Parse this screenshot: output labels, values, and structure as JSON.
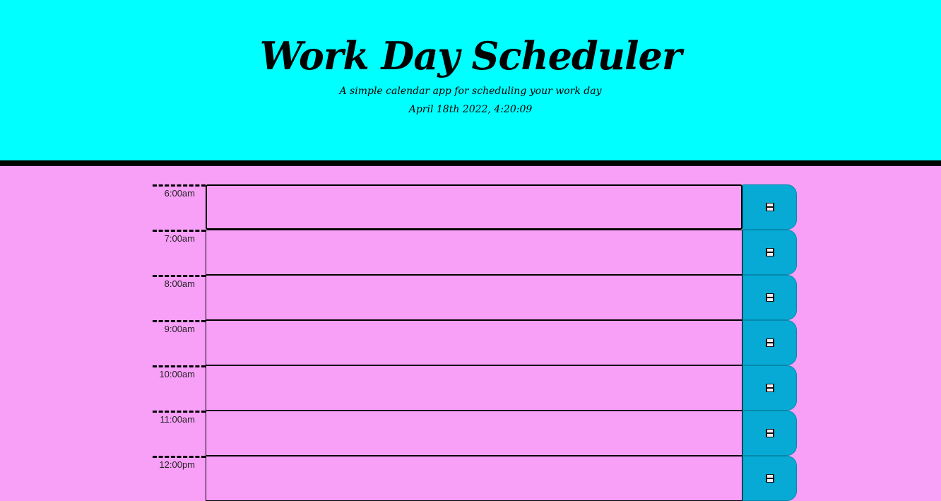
{
  "header": {
    "title": "Work Day Scheduler",
    "lead": "A simple calendar app for scheduling your work day",
    "current_day": "April 18th 2022, 4:20:09"
  },
  "colors": {
    "header_bg": "#00ffff",
    "body_bg": "#f8a0f8",
    "save_button": "#06aad4"
  },
  "timeblocks": [
    {
      "hour": "6:00am",
      "text": "",
      "save_icon": "floppy-disk-icon"
    },
    {
      "hour": "7:00am",
      "text": "",
      "save_icon": "floppy-disk-icon"
    },
    {
      "hour": "8:00am",
      "text": "",
      "save_icon": "floppy-disk-icon"
    },
    {
      "hour": "9:00am",
      "text": "",
      "save_icon": "floppy-disk-icon"
    },
    {
      "hour": "10:00am",
      "text": "",
      "save_icon": "floppy-disk-icon"
    },
    {
      "hour": "11:00am",
      "text": "",
      "save_icon": "floppy-disk-icon"
    },
    {
      "hour": "12:00pm",
      "text": "",
      "save_icon": "floppy-disk-icon"
    }
  ]
}
